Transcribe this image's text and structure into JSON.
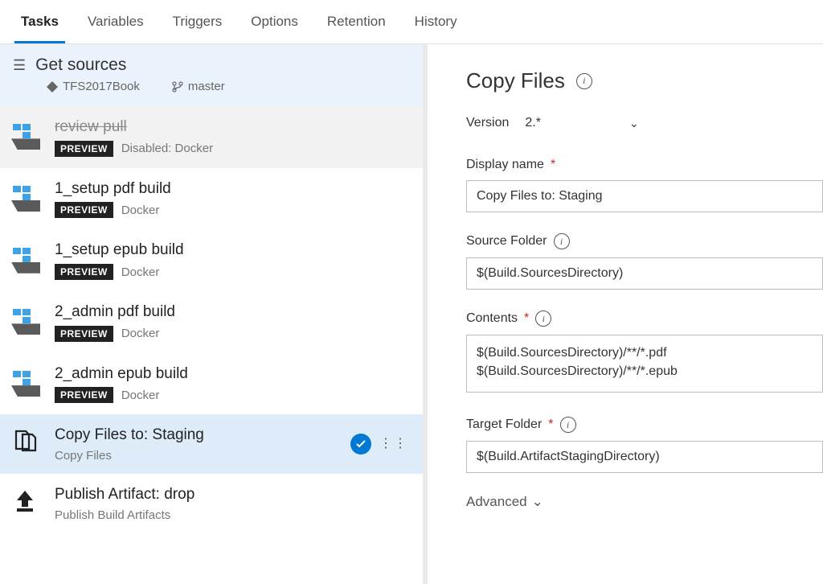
{
  "tabs": {
    "tasks": "Tasks",
    "variables": "Variables",
    "triggers": "Triggers",
    "options": "Options",
    "retention": "Retention",
    "history": "History"
  },
  "sources": {
    "title": "Get sources",
    "repo": "TFS2017Book",
    "branch": "master"
  },
  "badge": "PREVIEW",
  "tasks": [
    {
      "title": "review pull",
      "sub": "Disabled: Docker"
    },
    {
      "title": "1_setup pdf build",
      "sub": "Docker"
    },
    {
      "title": "1_setup epub build",
      "sub": "Docker"
    },
    {
      "title": "2_admin pdf build",
      "sub": "Docker"
    },
    {
      "title": "2_admin epub build",
      "sub": "Docker"
    },
    {
      "title": "Copy Files to: Staging",
      "sub": "Copy Files"
    },
    {
      "title": "Publish Artifact: drop",
      "sub": "Publish Build Artifacts"
    }
  ],
  "panel": {
    "title": "Copy Files",
    "version_label": "Version",
    "version_value": "2.*",
    "display_name_label": "Display name",
    "display_name_value": "Copy Files to: Staging",
    "source_folder_label": "Source Folder",
    "source_folder_value": "$(Build.SourcesDirectory)",
    "contents_label": "Contents",
    "contents_value": "$(Build.SourcesDirectory)/**/*.pdf\n$(Build.SourcesDirectory)/**/*.epub",
    "target_folder_label": "Target Folder",
    "target_folder_value": "$(Build.ArtifactStagingDirectory)",
    "advanced": "Advanced"
  }
}
